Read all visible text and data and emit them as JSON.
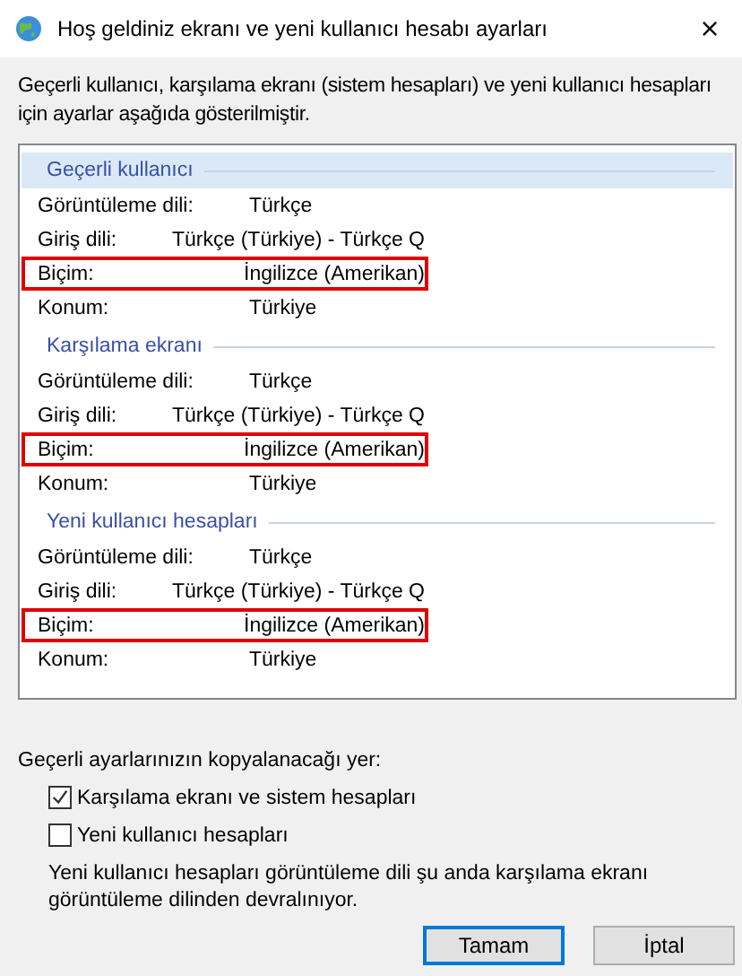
{
  "window": {
    "title": "Hoş geldiniz ekranı ve yeni kullanıcı hesabı ayarları",
    "close": "×"
  },
  "intro": "Geçerli kullanıcı, karşılama ekranı (sistem hesapları) ve yeni kullanıcı hesapları için ayarlar aşağıda gösterilmiştir.",
  "groups": [
    {
      "title": "Geçerli kullanıcı",
      "selected": true,
      "rows": [
        {
          "label": "Görüntüleme dili:",
          "value": "Türkçe",
          "highlighted": false
        },
        {
          "label": "Giriş dili:",
          "value": "Türkçe (Türkiye) - Türkçe Q",
          "highlighted": false
        },
        {
          "label": "Biçim:",
          "value": "İngilizce (Amerikan)",
          "highlighted": true
        },
        {
          "label": "Konum:",
          "value": "Türkiye",
          "highlighted": false
        }
      ]
    },
    {
      "title": "Karşılama ekranı",
      "selected": false,
      "rows": [
        {
          "label": "Görüntüleme dili:",
          "value": "Türkçe",
          "highlighted": false
        },
        {
          "label": "Giriş dili:",
          "value": "Türkçe (Türkiye) - Türkçe Q",
          "highlighted": false
        },
        {
          "label": "Biçim:",
          "value": "İngilizce (Amerikan)",
          "highlighted": true
        },
        {
          "label": "Konum:",
          "value": "Türkiye",
          "highlighted": false
        }
      ]
    },
    {
      "title": "Yeni kullanıcı hesapları",
      "selected": false,
      "rows": [
        {
          "label": "Görüntüleme dili:",
          "value": "Türkçe",
          "highlighted": false
        },
        {
          "label": "Giriş dili:",
          "value": "Türkçe (Türkiye) - Türkçe Q",
          "highlighted": false
        },
        {
          "label": "Biçim:",
          "value": "İngilizce (Amerikan)",
          "highlighted": true
        },
        {
          "label": "Konum:",
          "value": "Türkiye",
          "highlighted": false
        }
      ]
    }
  ],
  "copy_label": "Geçerli ayarlarınızın kopyalanacağı yer:",
  "checkboxes": [
    {
      "label": "Karşılama ekranı ve sistem hesapları",
      "checked": true
    },
    {
      "label": "Yeni kullanıcı hesapları",
      "checked": false
    }
  ],
  "note": "Yeni kullanıcı hesapları görüntüleme dili şu anda karşılama ekranı görüntüleme dilinden devralınıyor.",
  "buttons": [
    {
      "label": "Tamam",
      "default": true
    },
    {
      "label": "İptal",
      "default": false
    }
  ]
}
